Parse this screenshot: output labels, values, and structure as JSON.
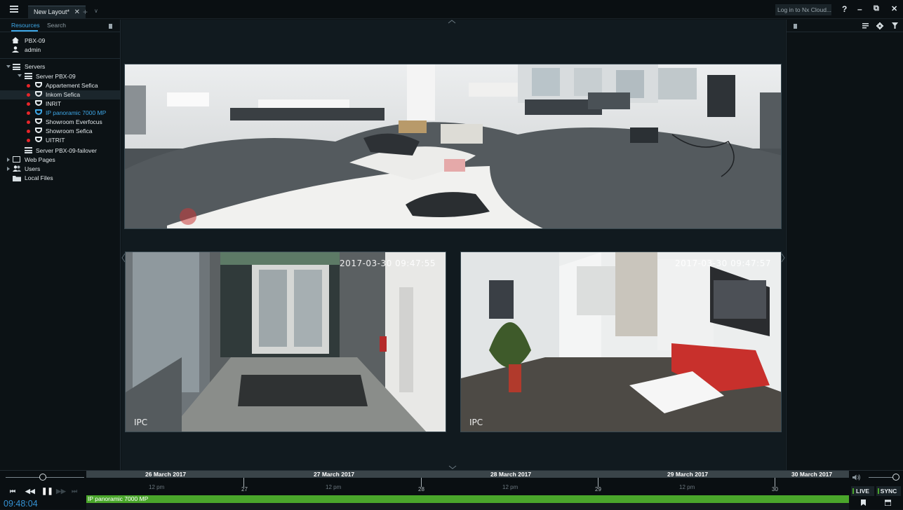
{
  "topbar": {
    "tab_label": "New Layout*",
    "tab_close": "✕",
    "tab_add": "+",
    "tab_list": "∨",
    "cloud_button": "Log in to Nx Cloud...",
    "help": "?",
    "minimize": "–",
    "restore": "⧉",
    "close": "✕"
  },
  "sidebar": {
    "tabs": [
      "Resources",
      "Search"
    ],
    "system_name": "PBX-09",
    "user": "admin",
    "servers_label": "Servers",
    "server_name": "Server PBX-09",
    "cameras": [
      "Appartement Sefica",
      "Inkom Sefica",
      "INRIT",
      "IP panoramic 7000 MP",
      "Showroom Everfocus",
      "Showroom Sefica",
      "UITRIT"
    ],
    "failover_server": "Server PBX-09-failover",
    "web_pages": "Web Pages",
    "users": "Users",
    "local_files": "Local Files"
  },
  "scene": {
    "tile_left": {
      "timestamp": "2017-03-30 09:47:55",
      "overlay": "IPC"
    },
    "tile_right": {
      "timestamp": "2017-03-30 09:47:57",
      "overlay": "IPC"
    }
  },
  "timeline": {
    "clock": "09:48:04",
    "dates": [
      "26 March 2017",
      "27 March 2017",
      "28 March 2017",
      "29 March 2017",
      "30 March 2017"
    ],
    "day_numbers": [
      "27",
      "28",
      "29",
      "30"
    ],
    "noon_label": "12 pm",
    "record_label": "IP panoramic 7000 MP",
    "live": "LIVE",
    "sync": "SYNC"
  },
  "colors": {
    "accent": "#3ea8e8",
    "recording": "#4aa62b",
    "offline": "#e8252a"
  }
}
